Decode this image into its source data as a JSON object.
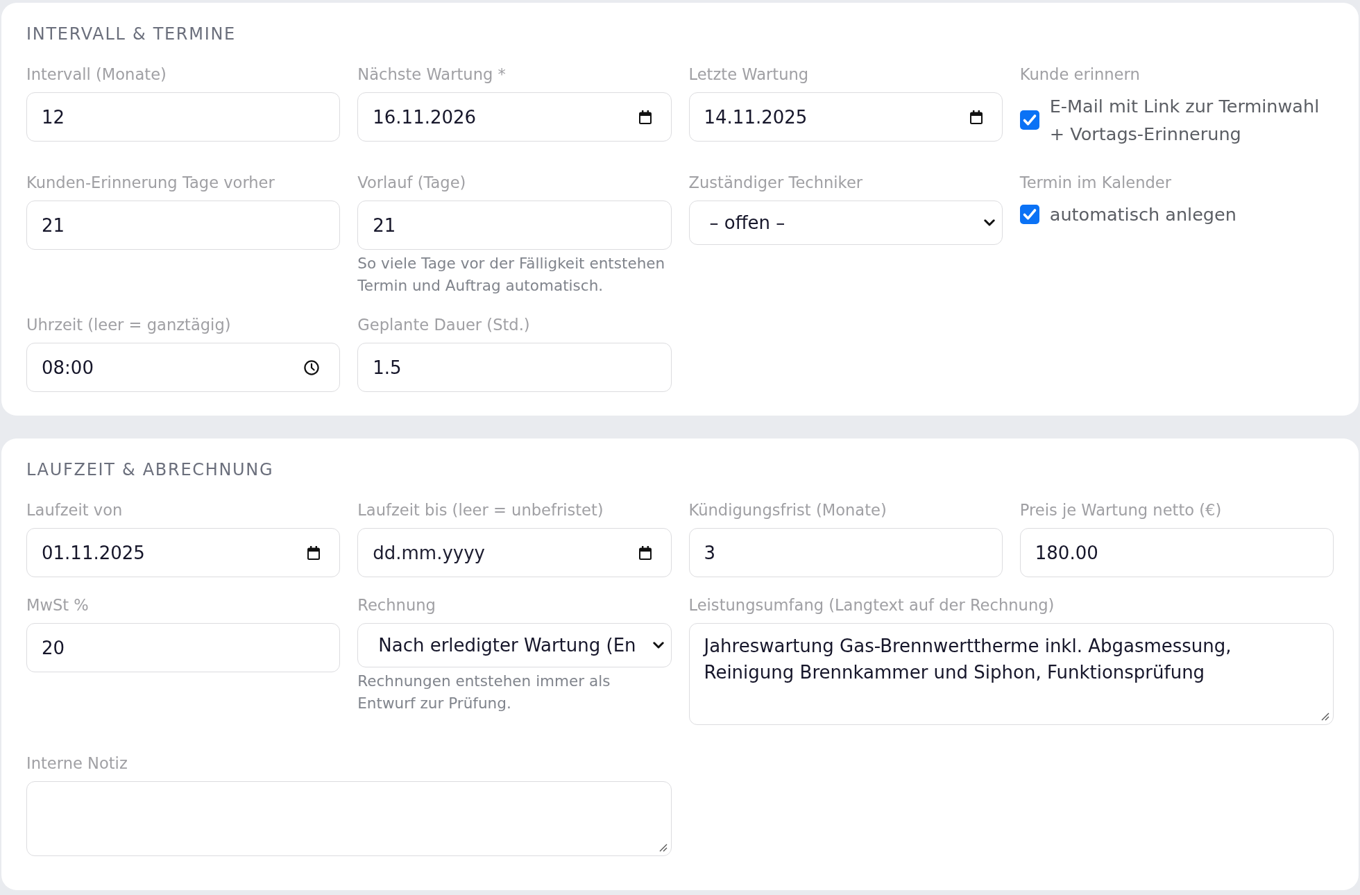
{
  "sections": [
    {
      "title": "INTERVALL & TERMINE",
      "fields": [
        {
          "kind": "text",
          "label": "Intervall (Monate)",
          "value": "12"
        },
        {
          "kind": "date",
          "label": "Nächste Wartung *",
          "value": "16.11.2026"
        },
        {
          "kind": "date",
          "label": "Letzte Wartung",
          "value": "14.11.2025"
        },
        {
          "kind": "checkbox",
          "label": "Kunde erinnern",
          "text": "E-Mail mit Link zur Terminwahl + Vortags-Erinnerung",
          "checked": true
        },
        {
          "kind": "text",
          "label": "Kunden-Erinnerung Tage vorher",
          "value": "21"
        },
        {
          "kind": "text",
          "label": "Vorlauf (Tage)",
          "value": "21",
          "help": "So viele Tage vor der Fälligkeit entstehen Termin und Auftrag automatisch."
        },
        {
          "kind": "select",
          "label": "Zuständiger Techniker",
          "value": "– offen –"
        },
        {
          "kind": "checkbox",
          "label": "Termin im Kalender",
          "text": "automatisch anlegen",
          "checked": true
        },
        {
          "kind": "time",
          "label": "Uhrzeit (leer = ganztägig)",
          "value": "08:00"
        },
        {
          "kind": "text",
          "label": "Geplante Dauer (Std.)",
          "value": "1.5"
        }
      ]
    },
    {
      "title": "LAUFZEIT & ABRECHNUNG",
      "fields": [
        {
          "kind": "date",
          "label": "Laufzeit von",
          "value": "01.11.2025"
        },
        {
          "kind": "date",
          "label": "Laufzeit bis (leer = unbefristet)",
          "placeholder": "dd.mm.yyyy"
        },
        {
          "kind": "text",
          "label": "Kündigungsfrist (Monate)",
          "value": "3"
        },
        {
          "kind": "text",
          "label": "Preis je Wartung netto (€)",
          "value": "180.00"
        },
        {
          "kind": "text",
          "label": "MwSt %",
          "value": "20"
        },
        {
          "kind": "select",
          "label": "Rechnung",
          "value": "Nach erledigter Wartung (En",
          "help": "Rechnungen entstehen immer als Entwurf zur Prüfung."
        },
        {
          "kind": "textarea",
          "label": "Leistungsumfang (Langtext auf der Rechnung)",
          "value": "Jahreswartung Gas-Brennwerttherme inkl. Abgasmessung, Reinigung Brennkammer und Siphon, Funktionsprüfung"
        },
        {
          "kind": "textarea",
          "label": "Interne Notiz"
        }
      ]
    }
  ]
}
